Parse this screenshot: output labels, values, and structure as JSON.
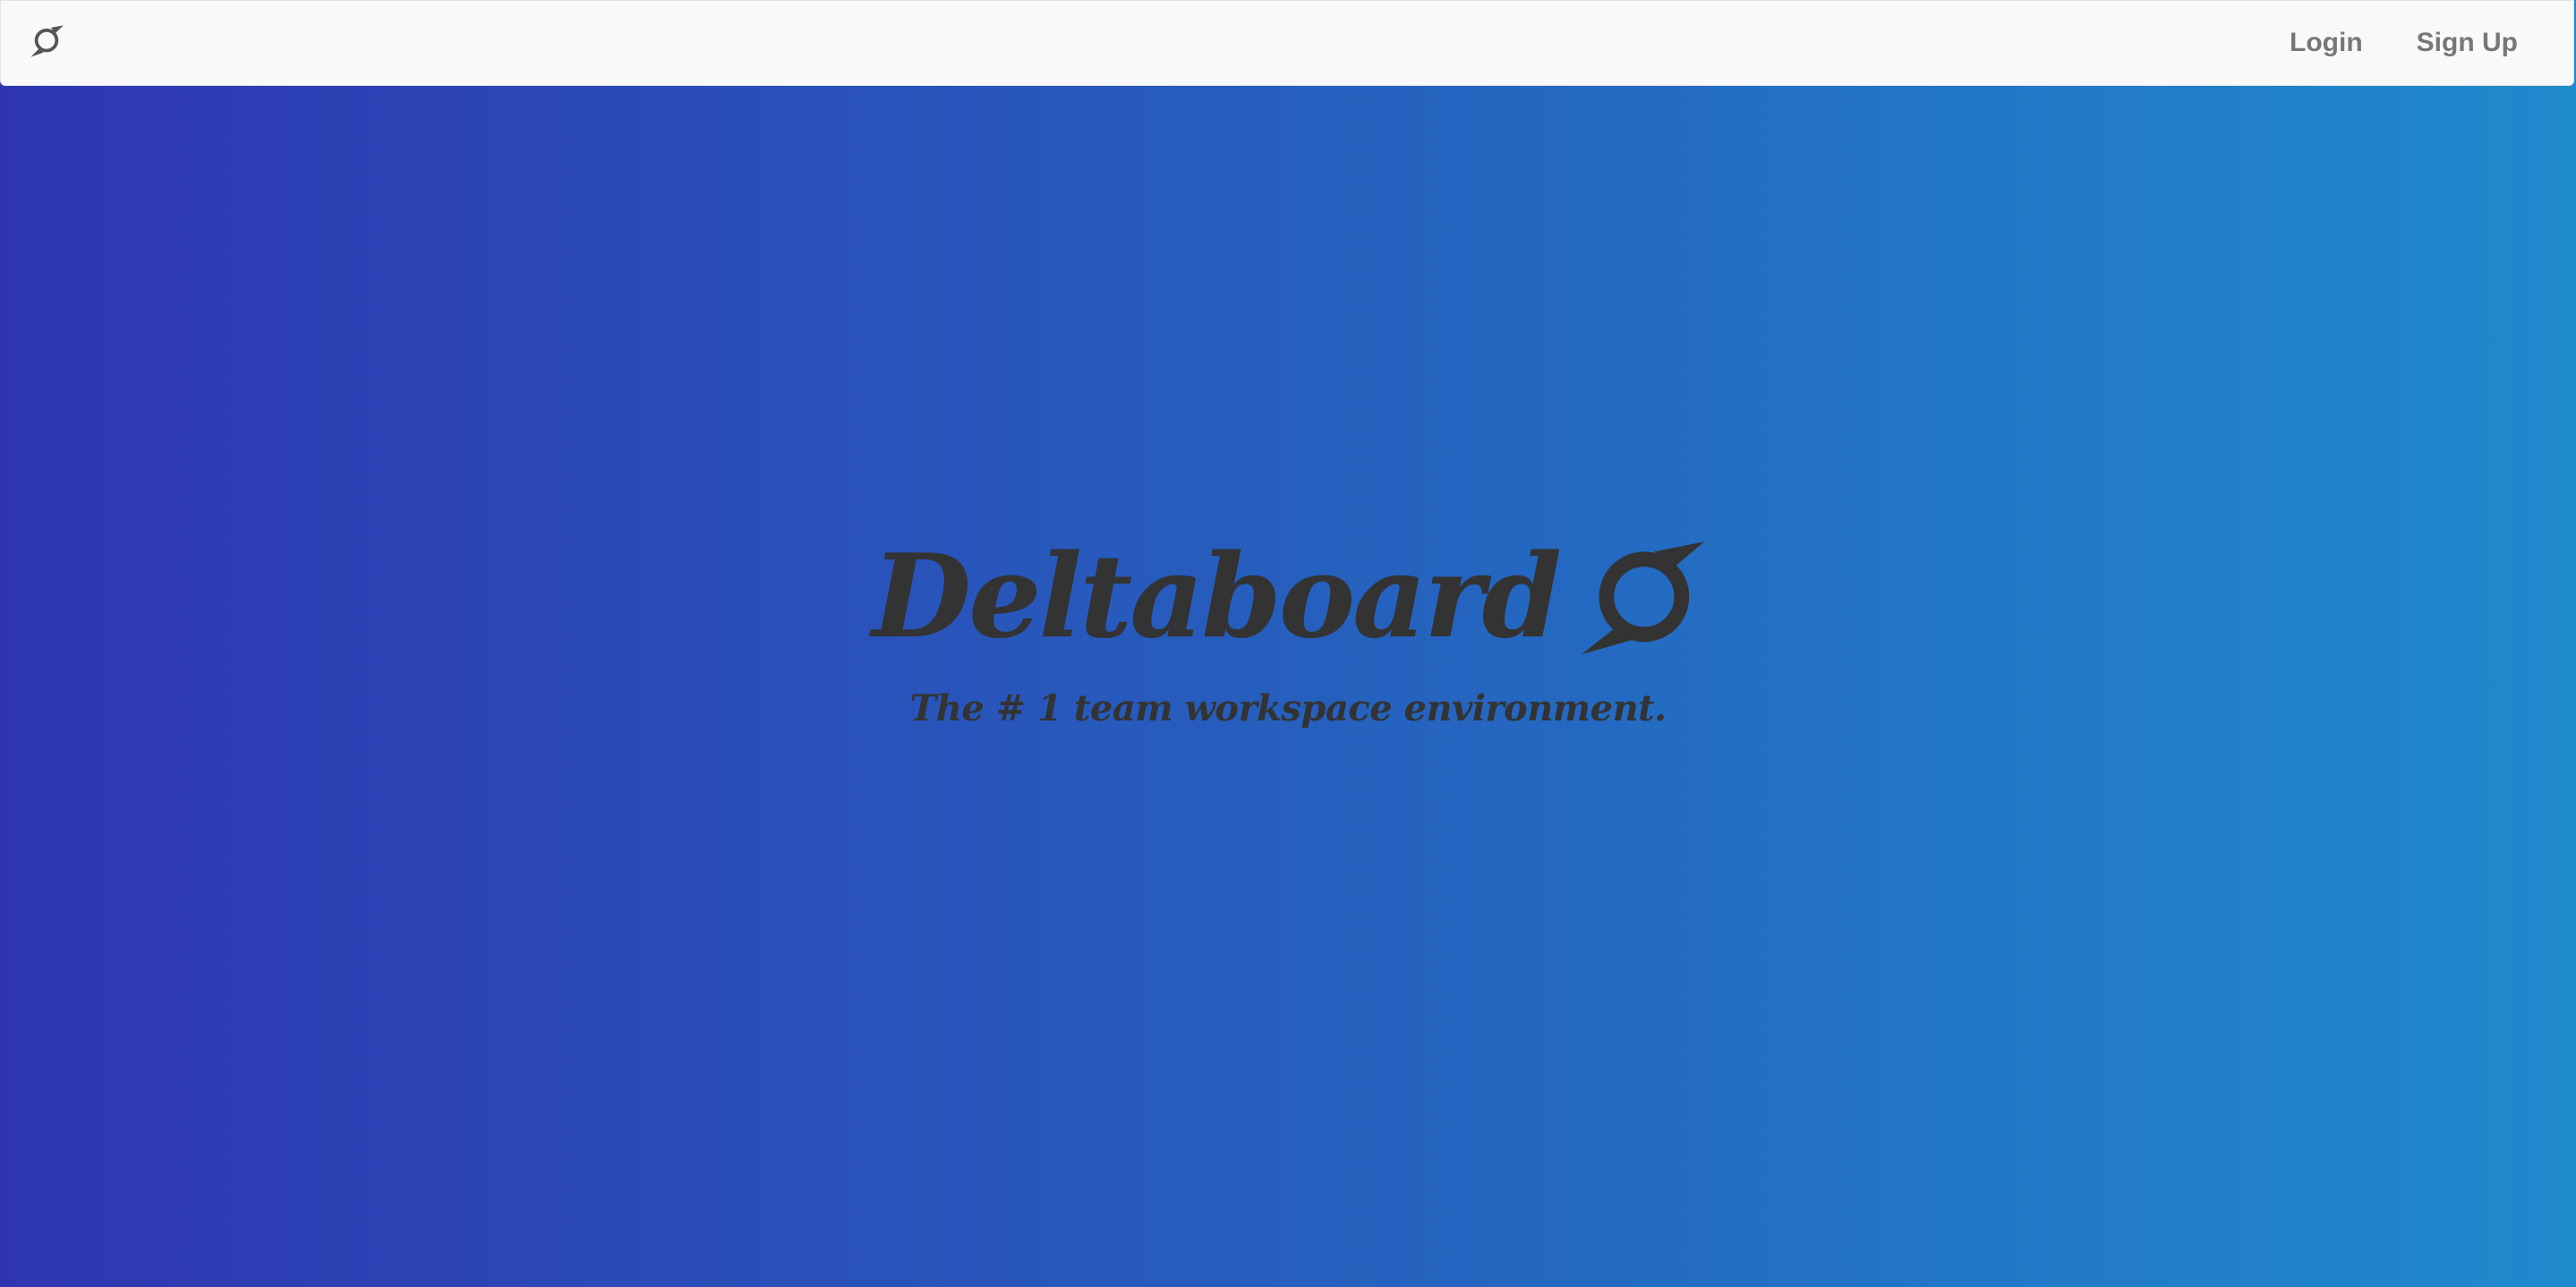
{
  "nav": {
    "logo_icon": "deltaboard-logo-icon",
    "login_label": "Login",
    "signup_label": "Sign Up"
  },
  "hero": {
    "title": "Deltaboard",
    "logo_icon": "deltaboard-logo-icon",
    "subtitle": "The # 1 team workspace environment."
  },
  "colors": {
    "gradient_start": "#2f35b1",
    "gradient_end": "#1f8acc",
    "navbar_bg": "#f9f9f9",
    "nav_text": "#777777",
    "hero_text": "#333333"
  }
}
